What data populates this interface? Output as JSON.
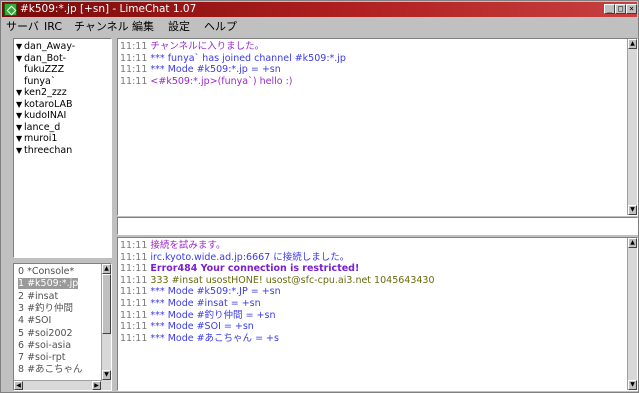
{
  "window": {
    "title": "#k509:*.jp [+sn] - LimeChat 1.07",
    "controls": {
      "minimize": "_",
      "maximize": "□",
      "close": "×"
    }
  },
  "menu": [
    "サーバ",
    "IRC",
    "チャンネル",
    "編集",
    "設定",
    "ヘルプ"
  ],
  "nicks": [
    {
      "name": "dan_Away-",
      "arrow": true
    },
    {
      "name": "dan_Bot-",
      "arrow": true
    },
    {
      "name": "fukuZZZ",
      "arrow": false
    },
    {
      "name": "funya`",
      "arrow": false
    },
    {
      "name": "ken2_zzz",
      "arrow": true
    },
    {
      "name": "kotaroLAB",
      "arrow": true
    },
    {
      "name": "kudoINAI",
      "arrow": true
    },
    {
      "name": "lance_d",
      "arrow": true
    },
    {
      "name": "muroi1",
      "arrow": true
    },
    {
      "name": "threechan",
      "arrow": true
    }
  ],
  "channels": [
    {
      "label": "0 *Console*"
    },
    {
      "label": "1 #k509:*.jp"
    },
    {
      "label": "2 #insat"
    },
    {
      "label": "3 #釣り仲間"
    },
    {
      "label": "4 #SOI"
    },
    {
      "label": "5 #soi2002"
    },
    {
      "label": "6 #soi-asia"
    },
    {
      "label": "7 #soi-rpt"
    },
    {
      "label": "8 #あこちゃん"
    }
  ],
  "channel_selected_index": 1,
  "chat_lines": [
    {
      "time": "11:11",
      "text": "チャンネルに入りました。",
      "color": "purple"
    },
    {
      "time": "11:11",
      "text": "*** funya` has joined channel #k509:*.jp",
      "color": "blue"
    },
    {
      "time": "11:11",
      "text": "*** Mode #k509:*.jp = +sn",
      "color": "blue"
    },
    {
      "time": "11:11",
      "text": "<#k509:*.jp>(funya`) hello :)",
      "color": "purple"
    }
  ],
  "console_lines": [
    {
      "time": "11:11",
      "text": "接続を試みます。",
      "color": "purple"
    },
    {
      "time": "11:11",
      "text": "irc.kyoto.wide.ad.jp:6667 に接続しました。",
      "color": "blue"
    },
    {
      "time": "11:11",
      "text": "Error484 Your connection is restricted!",
      "color": "bold"
    },
    {
      "time": "11:11",
      "text": "333 #insat usostHONE! usost@sfc-cpu.ai3.net 1045643430",
      "color": "olive"
    },
    {
      "time": "11:11",
      "text": "*** Mode #k509:*.JP = +sn",
      "color": "blue"
    },
    {
      "time": "11:11",
      "text": "*** Mode #insat = +sn",
      "color": "blue"
    },
    {
      "time": "11:11",
      "text": "*** Mode #釣り仲間 = +sn",
      "color": "blue"
    },
    {
      "time": "11:11",
      "text": "*** Mode #SOI = +sn",
      "color": "blue"
    },
    {
      "time": "11:11",
      "text": "*** Mode #あこちゃん = +s",
      "color": "blue"
    }
  ],
  "input": {
    "value": ""
  },
  "decor": {
    "flake": "✱",
    "nick_arrow": "▼"
  },
  "colors": {
    "titlebar": "#b02020",
    "chat_blue": "#3a3aee",
    "chat_purple": "#9a28d0",
    "selected": "#9a9a9a"
  }
}
